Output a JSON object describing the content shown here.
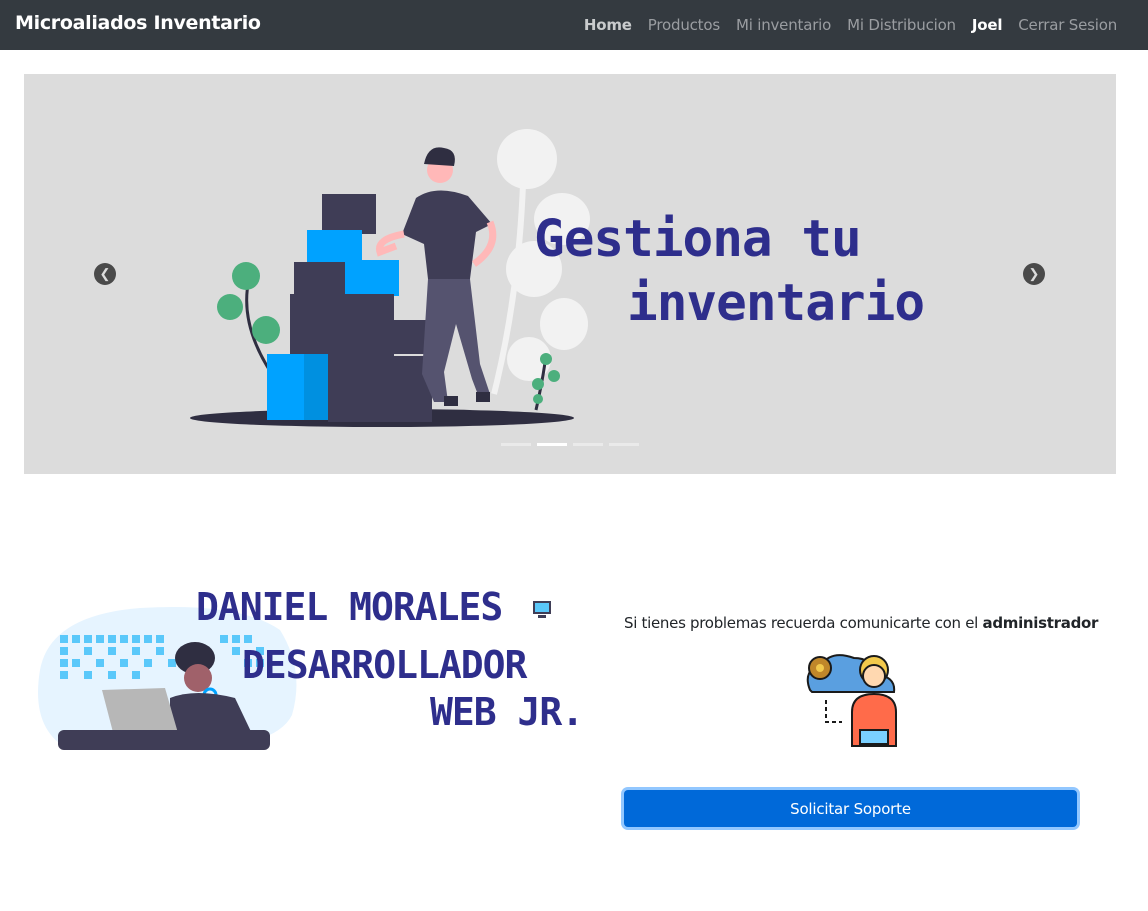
{
  "navbar": {
    "brand": "Microaliados Inventario",
    "links": [
      "Home",
      "Productos",
      "Mi inventario",
      "Mi Distribucion",
      "Joel",
      "Cerrar Sesion"
    ]
  },
  "carousel": {
    "headline_line1": "Gestiona tu",
    "headline_line2": "inventario",
    "prev_icon": "chevron-left-icon",
    "next_icon": "chevron-right-icon",
    "slide_count": 4,
    "active_slide": 2
  },
  "profile": {
    "name": "DANIEL MORALES",
    "role_line1": "DESARROLLADOR",
    "role_line2": "WEB JR."
  },
  "support": {
    "text_prefix": "Si tienes problemas recuerda comunicarte con el ",
    "text_bold": "administrador",
    "button_label": "Solicitar Soporte"
  },
  "colors": {
    "navbar_bg": "#343a40",
    "headline": "#2e2e8c",
    "button": "#0069d9",
    "carousel_bg": "#dcdcdc"
  }
}
